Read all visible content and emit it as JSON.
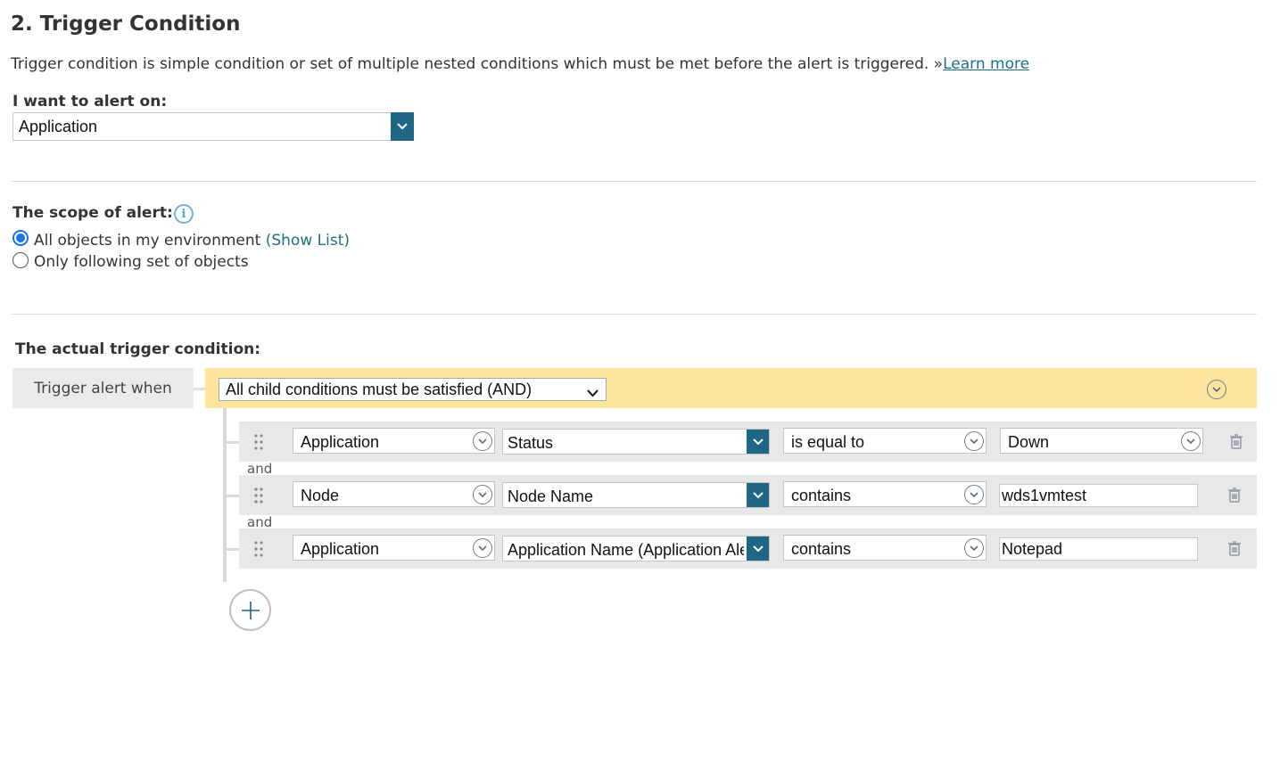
{
  "section": {
    "title": "2. Trigger Condition",
    "description": "Trigger condition is simple condition or set of multiple nested conditions which must be met before the alert is triggered. »",
    "learn_more": "Learn more"
  },
  "alert_on": {
    "label": "I want to alert on:",
    "value": "Application"
  },
  "scope": {
    "label": "The scope of alert:",
    "options": [
      {
        "label": "All objects in my environment",
        "link": "(Show List)",
        "selected": true
      },
      {
        "label": "Only following set of objects",
        "selected": false
      }
    ]
  },
  "trigger": {
    "label": "The actual trigger condition:",
    "when_label": "Trigger alert when",
    "combinator": "All child conditions must be satisfied (AND)",
    "joiner": "and",
    "conditions": [
      {
        "object": "Application",
        "field": "Status",
        "operator": "is equal to",
        "value": "Down",
        "value_type": "select"
      },
      {
        "object": "Node",
        "field": "Node Name",
        "operator": "contains",
        "value": "wds1vmtest",
        "value_type": "text"
      },
      {
        "object": "Application",
        "field": "Application Name (Application Ale",
        "operator": "contains",
        "value": "Notepad",
        "value_type": "text"
      }
    ]
  },
  "icons": {
    "info": "info-icon",
    "dropdown": "chevron-down-icon",
    "circle_dropdown": "circle-chevron-down-icon",
    "drag": "drag-handle-icon",
    "delete": "trash-icon",
    "add": "plus-icon"
  },
  "colors": {
    "accent": "#1f6784",
    "link": "#1d6f8a",
    "highlight_bar": "#fee59f",
    "radio_selected": "#1a73e8"
  }
}
